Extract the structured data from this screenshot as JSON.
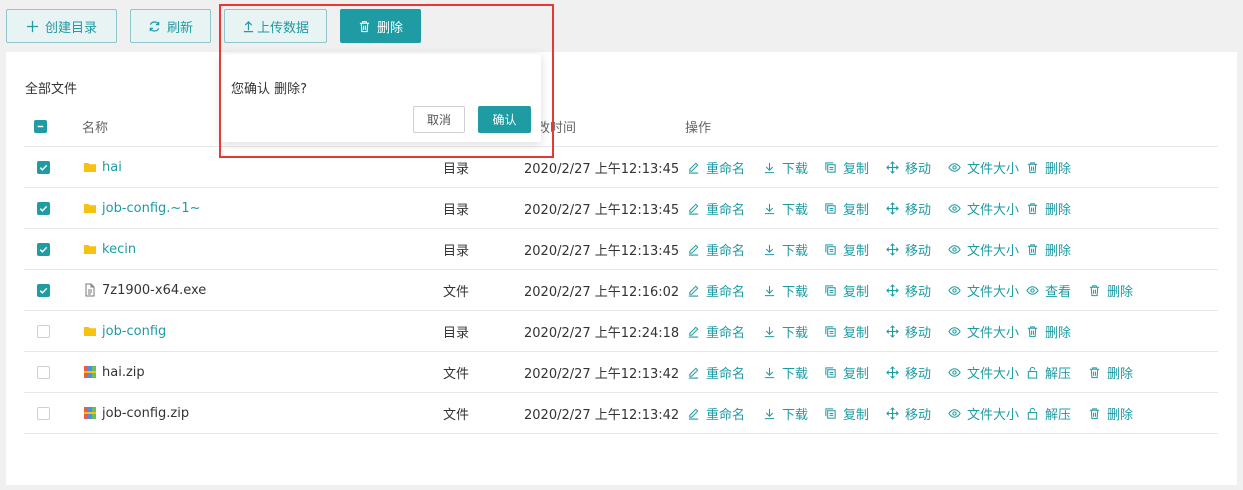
{
  "toolbar": {
    "create_dir": "创建目录",
    "refresh": "刷新",
    "upload": "上传数据",
    "delete": "删除"
  },
  "breadcrumb": "全部文件",
  "table": {
    "headers": {
      "name": "名称",
      "time": "修改时间",
      "ops": "操作"
    },
    "rows": [
      {
        "name": "hai",
        "kind": "folder",
        "type": "目录",
        "time": "2020/2/27 上午12:13:45",
        "checked": true
      },
      {
        "name": "job-config.~1~",
        "kind": "folder",
        "type": "目录",
        "time": "2020/2/27 上午12:13:45",
        "checked": true
      },
      {
        "name": "kecin",
        "kind": "folder",
        "type": "目录",
        "time": "2020/2/27 上午12:13:45",
        "checked": true
      },
      {
        "name": "7z1900-x64.exe",
        "kind": "file",
        "type": "文件",
        "time": "2020/2/27 上午12:16:02",
        "checked": true
      },
      {
        "name": "job-config",
        "kind": "folder",
        "type": "目录",
        "time": "2020/2/27 上午12:24:18",
        "checked": false
      },
      {
        "name": "hai.zip",
        "kind": "zip",
        "type": "文件",
        "time": "2020/2/27 上午12:13:42",
        "checked": false
      },
      {
        "name": "job-config.zip",
        "kind": "zip",
        "type": "文件",
        "time": "2020/2/27 上午12:13:42",
        "checked": false
      }
    ]
  },
  "ops": {
    "rename": "重命名",
    "download": "下载",
    "copy": "复制",
    "move": "移动",
    "size": "文件大小",
    "view": "查看",
    "unzip": "解压",
    "delete": "删除"
  },
  "popover": {
    "message": "您确认 删除?",
    "cancel": "取消",
    "confirm": "确认"
  },
  "colors": {
    "accent": "#1e9ba3",
    "folder": "#f5c211",
    "highlight": "#e53935"
  }
}
